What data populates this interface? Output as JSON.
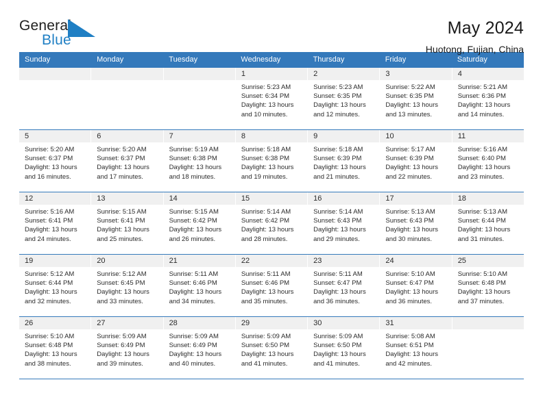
{
  "logo": {
    "word_top": "General",
    "word_bottom": "Blue",
    "triangle_icon": "blue-triangle-icon",
    "accent_color": "#1f7fc4"
  },
  "header": {
    "title": "May 2024",
    "subtitle": "Huotong, Fujian, China"
  },
  "theme": {
    "header_blue": "#3479bb",
    "band_gray": "#f0f0f0",
    "text": "#2b2b2b"
  },
  "calendar": {
    "day_headers": [
      "Sunday",
      "Monday",
      "Tuesday",
      "Wednesday",
      "Thursday",
      "Friday",
      "Saturday"
    ],
    "labels": {
      "sunrise": "Sunrise:",
      "sunset": "Sunset:",
      "daylight": "Daylight:"
    },
    "weeks": [
      [
        {
          "day": "",
          "empty": true
        },
        {
          "day": "",
          "empty": true
        },
        {
          "day": "",
          "empty": true
        },
        {
          "day": "1",
          "sunrise": "Sunrise: 5:23 AM",
          "sunset": "Sunset: 6:34 PM",
          "daylight_1": "Daylight: 13 hours",
          "daylight_2": "and 10 minutes."
        },
        {
          "day": "2",
          "sunrise": "Sunrise: 5:23 AM",
          "sunset": "Sunset: 6:35 PM",
          "daylight_1": "Daylight: 13 hours",
          "daylight_2": "and 12 minutes."
        },
        {
          "day": "3",
          "sunrise": "Sunrise: 5:22 AM",
          "sunset": "Sunset: 6:35 PM",
          "daylight_1": "Daylight: 13 hours",
          "daylight_2": "and 13 minutes."
        },
        {
          "day": "4",
          "sunrise": "Sunrise: 5:21 AM",
          "sunset": "Sunset: 6:36 PM",
          "daylight_1": "Daylight: 13 hours",
          "daylight_2": "and 14 minutes."
        }
      ],
      [
        {
          "day": "5",
          "sunrise": "Sunrise: 5:20 AM",
          "sunset": "Sunset: 6:37 PM",
          "daylight_1": "Daylight: 13 hours",
          "daylight_2": "and 16 minutes."
        },
        {
          "day": "6",
          "sunrise": "Sunrise: 5:20 AM",
          "sunset": "Sunset: 6:37 PM",
          "daylight_1": "Daylight: 13 hours",
          "daylight_2": "and 17 minutes."
        },
        {
          "day": "7",
          "sunrise": "Sunrise: 5:19 AM",
          "sunset": "Sunset: 6:38 PM",
          "daylight_1": "Daylight: 13 hours",
          "daylight_2": "and 18 minutes."
        },
        {
          "day": "8",
          "sunrise": "Sunrise: 5:18 AM",
          "sunset": "Sunset: 6:38 PM",
          "daylight_1": "Daylight: 13 hours",
          "daylight_2": "and 19 minutes."
        },
        {
          "day": "9",
          "sunrise": "Sunrise: 5:18 AM",
          "sunset": "Sunset: 6:39 PM",
          "daylight_1": "Daylight: 13 hours",
          "daylight_2": "and 21 minutes."
        },
        {
          "day": "10",
          "sunrise": "Sunrise: 5:17 AM",
          "sunset": "Sunset: 6:39 PM",
          "daylight_1": "Daylight: 13 hours",
          "daylight_2": "and 22 minutes."
        },
        {
          "day": "11",
          "sunrise": "Sunrise: 5:16 AM",
          "sunset": "Sunset: 6:40 PM",
          "daylight_1": "Daylight: 13 hours",
          "daylight_2": "and 23 minutes."
        }
      ],
      [
        {
          "day": "12",
          "sunrise": "Sunrise: 5:16 AM",
          "sunset": "Sunset: 6:41 PM",
          "daylight_1": "Daylight: 13 hours",
          "daylight_2": "and 24 minutes."
        },
        {
          "day": "13",
          "sunrise": "Sunrise: 5:15 AM",
          "sunset": "Sunset: 6:41 PM",
          "daylight_1": "Daylight: 13 hours",
          "daylight_2": "and 25 minutes."
        },
        {
          "day": "14",
          "sunrise": "Sunrise: 5:15 AM",
          "sunset": "Sunset: 6:42 PM",
          "daylight_1": "Daylight: 13 hours",
          "daylight_2": "and 26 minutes."
        },
        {
          "day": "15",
          "sunrise": "Sunrise: 5:14 AM",
          "sunset": "Sunset: 6:42 PM",
          "daylight_1": "Daylight: 13 hours",
          "daylight_2": "and 28 minutes."
        },
        {
          "day": "16",
          "sunrise": "Sunrise: 5:14 AM",
          "sunset": "Sunset: 6:43 PM",
          "daylight_1": "Daylight: 13 hours",
          "daylight_2": "and 29 minutes."
        },
        {
          "day": "17",
          "sunrise": "Sunrise: 5:13 AM",
          "sunset": "Sunset: 6:43 PM",
          "daylight_1": "Daylight: 13 hours",
          "daylight_2": "and 30 minutes."
        },
        {
          "day": "18",
          "sunrise": "Sunrise: 5:13 AM",
          "sunset": "Sunset: 6:44 PM",
          "daylight_1": "Daylight: 13 hours",
          "daylight_2": "and 31 minutes."
        }
      ],
      [
        {
          "day": "19",
          "sunrise": "Sunrise: 5:12 AM",
          "sunset": "Sunset: 6:44 PM",
          "daylight_1": "Daylight: 13 hours",
          "daylight_2": "and 32 minutes."
        },
        {
          "day": "20",
          "sunrise": "Sunrise: 5:12 AM",
          "sunset": "Sunset: 6:45 PM",
          "daylight_1": "Daylight: 13 hours",
          "daylight_2": "and 33 minutes."
        },
        {
          "day": "21",
          "sunrise": "Sunrise: 5:11 AM",
          "sunset": "Sunset: 6:46 PM",
          "daylight_1": "Daylight: 13 hours",
          "daylight_2": "and 34 minutes."
        },
        {
          "day": "22",
          "sunrise": "Sunrise: 5:11 AM",
          "sunset": "Sunset: 6:46 PM",
          "daylight_1": "Daylight: 13 hours",
          "daylight_2": "and 35 minutes."
        },
        {
          "day": "23",
          "sunrise": "Sunrise: 5:11 AM",
          "sunset": "Sunset: 6:47 PM",
          "daylight_1": "Daylight: 13 hours",
          "daylight_2": "and 36 minutes."
        },
        {
          "day": "24",
          "sunrise": "Sunrise: 5:10 AM",
          "sunset": "Sunset: 6:47 PM",
          "daylight_1": "Daylight: 13 hours",
          "daylight_2": "and 36 minutes."
        },
        {
          "day": "25",
          "sunrise": "Sunrise: 5:10 AM",
          "sunset": "Sunset: 6:48 PM",
          "daylight_1": "Daylight: 13 hours",
          "daylight_2": "and 37 minutes."
        }
      ],
      [
        {
          "day": "26",
          "sunrise": "Sunrise: 5:10 AM",
          "sunset": "Sunset: 6:48 PM",
          "daylight_1": "Daylight: 13 hours",
          "daylight_2": "and 38 minutes."
        },
        {
          "day": "27",
          "sunrise": "Sunrise: 5:09 AM",
          "sunset": "Sunset: 6:49 PM",
          "daylight_1": "Daylight: 13 hours",
          "daylight_2": "and 39 minutes."
        },
        {
          "day": "28",
          "sunrise": "Sunrise: 5:09 AM",
          "sunset": "Sunset: 6:49 PM",
          "daylight_1": "Daylight: 13 hours",
          "daylight_2": "and 40 minutes."
        },
        {
          "day": "29",
          "sunrise": "Sunrise: 5:09 AM",
          "sunset": "Sunset: 6:50 PM",
          "daylight_1": "Daylight: 13 hours",
          "daylight_2": "and 41 minutes."
        },
        {
          "day": "30",
          "sunrise": "Sunrise: 5:09 AM",
          "sunset": "Sunset: 6:50 PM",
          "daylight_1": "Daylight: 13 hours",
          "daylight_2": "and 41 minutes."
        },
        {
          "day": "31",
          "sunrise": "Sunrise: 5:08 AM",
          "sunset": "Sunset: 6:51 PM",
          "daylight_1": "Daylight: 13 hours",
          "daylight_2": "and 42 minutes."
        },
        {
          "day": "",
          "empty": true
        }
      ]
    ]
  }
}
